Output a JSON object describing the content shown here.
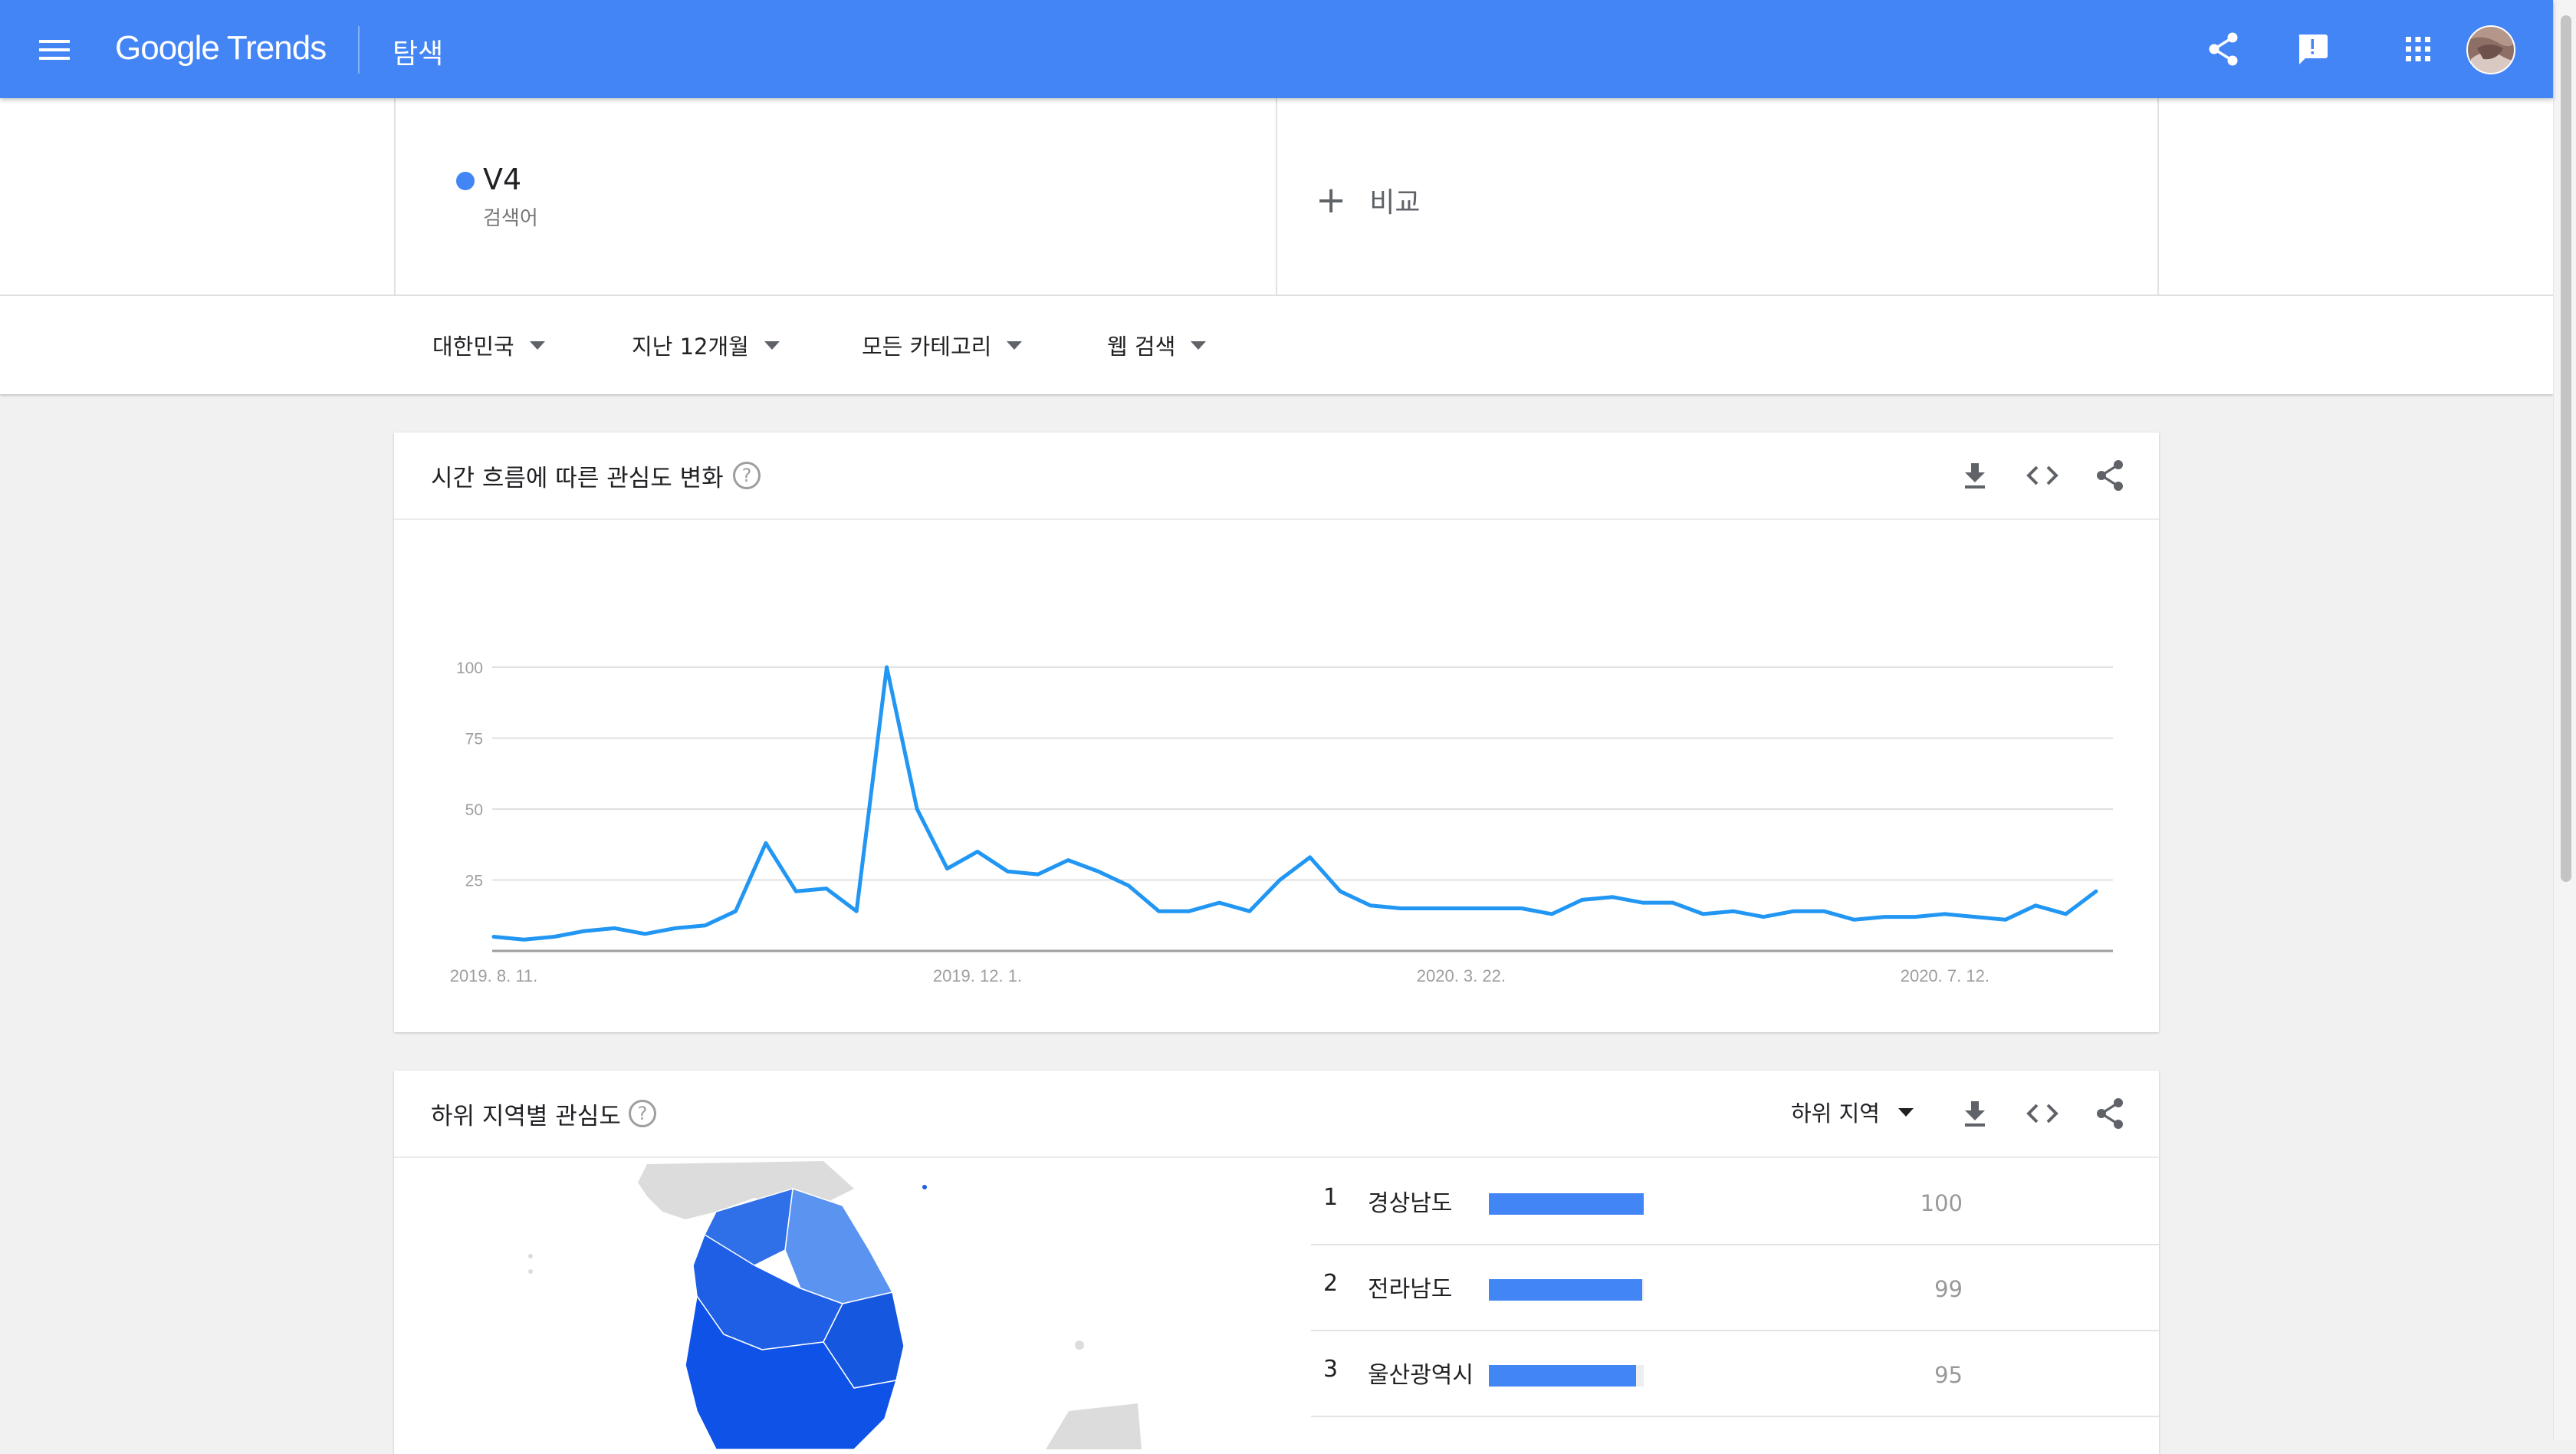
{
  "header": {
    "brand_google": "Google",
    "brand_trends": "Trends",
    "page_title": "탐색",
    "menu_icon": "menu-icon",
    "share_icon": "share-icon",
    "feedback_icon": "feedback-icon",
    "apps_icon": "apps-icon",
    "avatar_icon": "avatar"
  },
  "term": {
    "name": "V4",
    "subtitle": "검색어",
    "color": "#4285f4",
    "compare_label": "비교"
  },
  "filters": {
    "region": "대한민국",
    "period": "지난 12개월",
    "category": "모든 카테고리",
    "search_type": "웹 검색"
  },
  "interest_over_time": {
    "title": "시간 흐름에 따른 관심도 변화",
    "help": "?"
  },
  "chart_data": {
    "type": "line",
    "x_tick_labels": [
      "2019. 8. 11.",
      "2019. 12. 1.",
      "2020. 3. 22.",
      "2020. 7. 12."
    ],
    "y_ticks": [
      25,
      50,
      75,
      100
    ],
    "y_tick_labels": [
      "25",
      "50",
      "75",
      "100"
    ],
    "ylim": [
      0,
      100
    ],
    "grid": true,
    "series": [
      {
        "color": "#2196f3",
        "values": [
          5,
          4,
          5,
          7,
          8,
          6,
          8,
          9,
          14,
          38,
          21,
          22,
          14,
          100,
          50,
          29,
          35,
          28,
          27,
          32,
          28,
          23,
          14,
          14,
          17,
          14,
          25,
          33,
          21,
          16,
          15,
          15,
          15,
          15,
          15,
          13,
          18,
          19,
          17,
          17,
          13,
          14,
          12,
          14,
          14,
          11,
          12,
          12,
          13,
          12,
          11,
          16,
          13,
          21
        ]
      }
    ]
  },
  "interest_by_region": {
    "title": "하위 지역별 관심도",
    "help": "?",
    "resolution_label": "하위 지역",
    "rows": [
      {
        "rank": "1",
        "name": "경상남도",
        "value": "100",
        "share": 100
      },
      {
        "rank": "2",
        "name": "전라남도",
        "value": "99",
        "share": 99
      },
      {
        "rank": "3",
        "name": "울산광역시",
        "value": "95",
        "share": 95
      }
    ]
  }
}
